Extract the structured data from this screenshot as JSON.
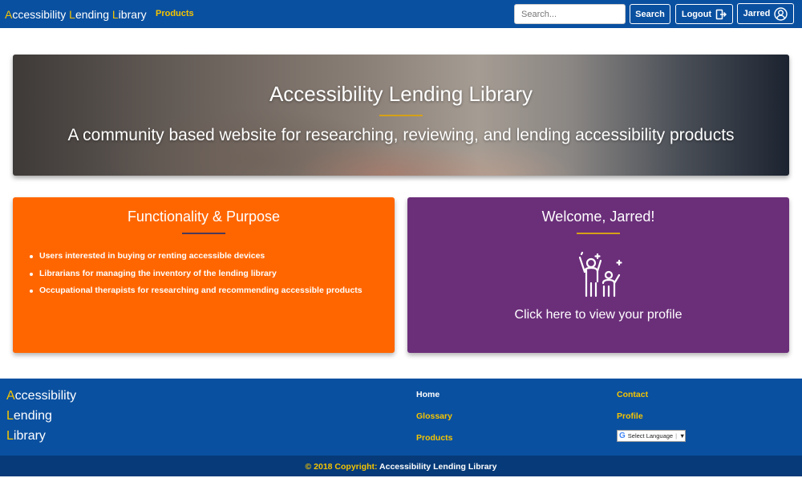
{
  "navbar": {
    "brand_first": "A",
    "brand_rest1": "ccessibility ",
    "brand_second": "L",
    "brand_rest2": "ending ",
    "brand_third": "L",
    "brand_rest3": "ibrary",
    "products_link": "Products",
    "search_placeholder": "Search...",
    "search_button": "Search",
    "logout_button": "Logout",
    "user_button": "Jarred",
    "colors": {
      "background": "#0a50a0",
      "accent": "#f5c400"
    }
  },
  "hero": {
    "title": "Accessibility Lending Library",
    "subtitle": "A community based website for researching, reviewing, and lending accessibility products"
  },
  "functionality_card": {
    "title": "Functionality & Purpose",
    "color": "#ff6600",
    "items": [
      "Users interested in buying or renting accessible devices",
      "Librarians for managing the inventory of the lending library",
      "Occupational therapists for researching and recommending accessible products"
    ]
  },
  "welcome_card": {
    "title": "Welcome, Jarred!",
    "color": "#6b2f7a",
    "icon": "celebrating-people-icon",
    "link": "Click here to view your profile"
  },
  "footer": {
    "brand_lines": [
      {
        "initial": "A",
        "rest": "ccessibility"
      },
      {
        "initial": "L",
        "rest": "ending"
      },
      {
        "initial": "L",
        "rest": "ibrary"
      }
    ],
    "links": {
      "home": "Home",
      "glossary": "Glossary",
      "products": "Products",
      "contact": "Contact",
      "profile": "Profile"
    },
    "language_select": {
      "g": "G",
      "label": "Select Language",
      "arrow": "▼"
    },
    "copyright_prefix": "© 2018 Copyright:",
    "copyright_name": "Accessibility Lending Library"
  }
}
